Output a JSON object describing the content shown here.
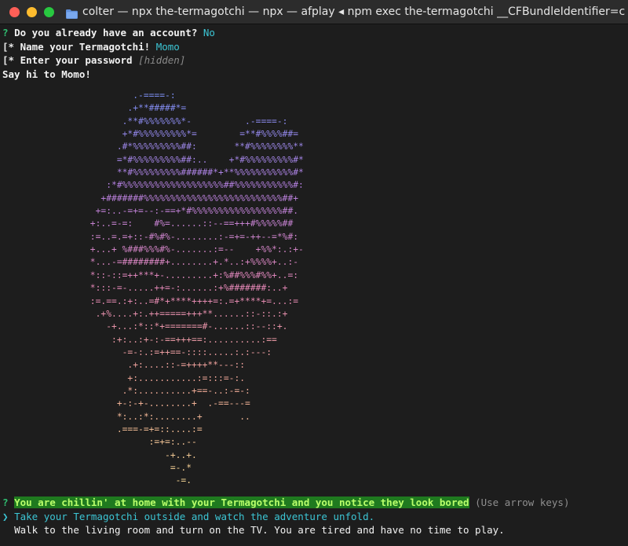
{
  "window": {
    "title": "colter — npx the-termagotchi — npx — afplay ◂ npm exec the-termagotchi __CFBundleIdentifier=c"
  },
  "prompts": {
    "account": {
      "marker": "?",
      "question": "Do you already have an account?",
      "answer": "No"
    },
    "name": {
      "marker": "[*",
      "question": "Name your Termagotchi!",
      "answer": "Momo"
    },
    "password": {
      "marker": "[*",
      "question": "Enter your password",
      "hint": "[hidden]"
    },
    "greeting": "Say hi to Momo!"
  },
  "ascii_art": {
    "gradient_colors": [
      "#7a8df0",
      "#b77fde",
      "#e487b6",
      "#f0a896",
      "#f2d392"
    ],
    "lines": [
      "              .-====-:",
      "             .+**#####*=",
      "            .**#%%%%%%%*-          .-====-:",
      "            +*#%%%%%%%%%*=        =**#%%%%##=",
      "           .#*%%%%%%%%%##:       **#%%%%%%%%**",
      "           =*#%%%%%%%%%##:..    +*#%%%%%%%%%#*",
      "           **#%%%%%%%%%######*+**%%%%%%%%%%%#*",
      "         :*#%%%%%%%%%%%%%%%%%%%##%%%%%%%%%%%#:",
      "        +#######%%%%%%%%%%%%%%%%%%%%%%%%%%##+",
      "       +=:..-=+=--:-==+*#%%%%%%%%%%%%%%%%%##.",
      "      +:..=-=:    #%=......::--==+++#%%%%%##",
      "      :=..=.=+::-#%#%-........:-=+=-++--=*%#:",
      "      +...+ %###%%%#%-.......:=--    +%%*:.:+-",
      "      *...-=########+........+.*..:+%%%%+..:-",
      "      *::-::=++***+-.........+:%##%%%#%%+..=:",
      "      *:::-=-.....++=-:......:+%#######:..+",
      "      :=.==.:+:..=#*+****++++=:.=+****+=...:=",
      "       .+%....+:.++=====+++**......::-::.:+",
      "         -+...:*::*+=======#-......::--::+.",
      "          :+:..:+-:-==+++==:..........:==",
      "            -=-:.:=++==-::::.....:.:---:",
      "             .+:....::-=++++**---::",
      "             +:...........:=:::=-:.",
      "            .*:..........+==-..:-=-:",
      "           +-:-+-........+  .-==---=",
      "           *:..:*:........+       ..",
      "           .===-=+=::....:=",
      "                 :=+=:..--",
      "                    -+..+.",
      "                     =-.*",
      "                      -=."
    ]
  },
  "bottom_prompt": {
    "marker": "?",
    "question": "You are chillin' at home with your Termagotchi and you notice they look bored",
    "hint": "(Use arrow keys)",
    "pointer": "❯",
    "choices": [
      "Take your Termagotchi outside and watch the adventure unfold.",
      "Walk to the living room and turn on the TV. You are tired and have no time to play."
    ]
  }
}
